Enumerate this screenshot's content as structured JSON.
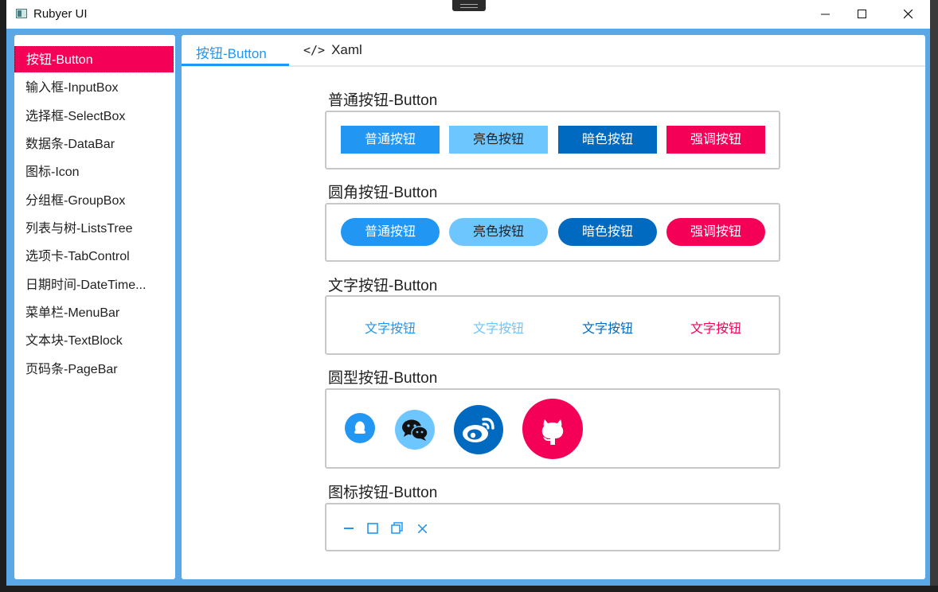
{
  "window": {
    "title": "Rubyer UI"
  },
  "sidebar": {
    "items": [
      {
        "label": "按钮-Button"
      },
      {
        "label": "输入框-InputBox"
      },
      {
        "label": "选择框-SelectBox"
      },
      {
        "label": "数据条-DataBar"
      },
      {
        "label": "图标-Icon"
      },
      {
        "label": "分组框-GroupBox"
      },
      {
        "label": "列表与树-ListsTree"
      },
      {
        "label": "选项卡-TabControl"
      },
      {
        "label": "日期时间-DateTime..."
      },
      {
        "label": "菜单栏-MenuBar"
      },
      {
        "label": "文本块-TextBlock"
      },
      {
        "label": "页码条-PageBar"
      }
    ]
  },
  "tabs": [
    {
      "label": "按钮-Button"
    },
    {
      "label": "Xaml"
    }
  ],
  "sections": {
    "normal": {
      "title": "普通按钮-Button",
      "buttons": [
        "普通按钮",
        "亮色按钮",
        "暗色按钮",
        "强调按钮"
      ]
    },
    "rounded": {
      "title": "圆角按钮-Button",
      "buttons": [
        "普通按钮",
        "亮色按钮",
        "暗色按钮",
        "强调按钮"
      ]
    },
    "text": {
      "title": "文字按钮-Button",
      "buttons": [
        "文字按钮",
        "文字按钮",
        "文字按钮",
        "文字按钮"
      ]
    },
    "circle": {
      "title": "圆型按钮-Button",
      "icons": [
        "qq-icon",
        "wechat-icon",
        "weibo-icon",
        "github-icon"
      ]
    },
    "icon": {
      "title": "图标按钮-Button",
      "icons": [
        "minimize-icon",
        "maximize-icon",
        "restore-icon",
        "close-icon"
      ]
    }
  },
  "colors": {
    "primary": "#2196f3",
    "light": "#6ec6ff",
    "dark": "#0069c0",
    "accent": "#f50057"
  }
}
